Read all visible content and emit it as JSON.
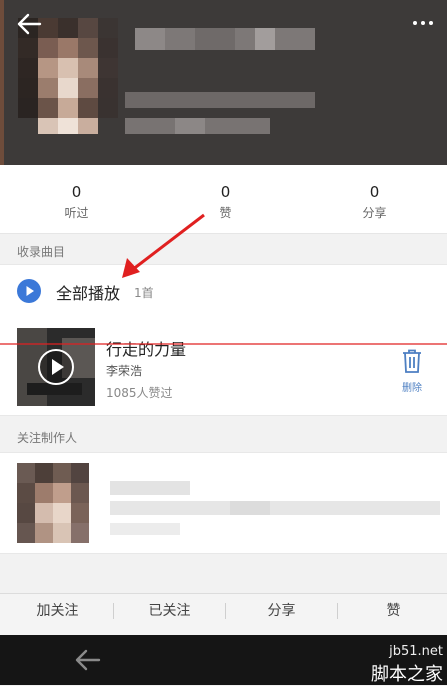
{
  "stats": [
    {
      "value": "0",
      "label": "听过"
    },
    {
      "value": "0",
      "label": "赞"
    },
    {
      "value": "0",
      "label": "分享"
    }
  ],
  "sections": {
    "songs_label": "收录曲目",
    "creator_label": "关注制作人"
  },
  "play_all": {
    "label": "全部播放",
    "count": "1首"
  },
  "song": {
    "title": "行走的力量",
    "artist": "李荣浩",
    "likes": "1085人赞过",
    "delete_label": "删除"
  },
  "tabs": [
    "加关注",
    "已关注",
    "分享",
    "赞"
  ],
  "watermark": {
    "site": "jb51.net",
    "name": "脚本之家"
  },
  "colors": {
    "accent_blue": "#3b78d8",
    "annotation_red": "#e02020",
    "header_bg": "#3d3a39",
    "nav_bg": "#151515"
  },
  "icons": {
    "back": "arrow-left-icon",
    "more": "more-vertical-icon",
    "play": "play-circle-icon",
    "delete": "trash-icon"
  }
}
